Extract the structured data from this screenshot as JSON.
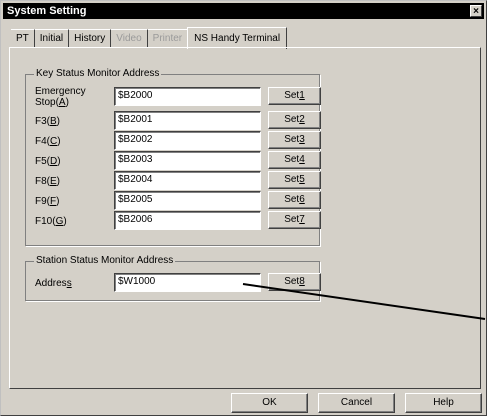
{
  "window": {
    "title": "System Setting",
    "close_glyph": "×"
  },
  "tabs": [
    {
      "label": "PT",
      "state": "normal"
    },
    {
      "label": "Initial",
      "state": "normal"
    },
    {
      "label": "History",
      "state": "normal"
    },
    {
      "label": "Video",
      "state": "disabled"
    },
    {
      "label": "Printer",
      "state": "disabled"
    },
    {
      "label": "NS Handy Terminal",
      "state": "active"
    }
  ],
  "key_group": {
    "legend": "Key Status Monitor Address",
    "rows": [
      {
        "label_pre": "Emergency\nStop(",
        "hotkey": "A",
        "label_post": ")",
        "value": "$B2000",
        "btn_pre": "Set",
        "btn_key": "1"
      },
      {
        "label_pre": "F3(",
        "hotkey": "B",
        "label_post": ")",
        "value": "$B2001",
        "btn_pre": "Set",
        "btn_key": "2"
      },
      {
        "label_pre": "F4(",
        "hotkey": "C",
        "label_post": ")",
        "value": "$B2002",
        "btn_pre": "Set",
        "btn_key": "3"
      },
      {
        "label_pre": "F5(",
        "hotkey": "D",
        "label_post": ")",
        "value": "$B2003",
        "btn_pre": "Set",
        "btn_key": "4"
      },
      {
        "label_pre": "F8(",
        "hotkey": "E",
        "label_post": ")",
        "value": "$B2004",
        "btn_pre": "Set",
        "btn_key": "5"
      },
      {
        "label_pre": "F9(",
        "hotkey": "F",
        "label_post": ")",
        "value": "$B2005",
        "btn_pre": "Set",
        "btn_key": "6"
      },
      {
        "label_pre": "F10(",
        "hotkey": "G",
        "label_post": ")",
        "value": "$B2006",
        "btn_pre": "Set",
        "btn_key": "7"
      }
    ]
  },
  "station_group": {
    "legend": "Station Status Monitor Address",
    "label_pre": "Addres",
    "hotkey": "s",
    "value": "$W1000",
    "btn_pre": "Set",
    "btn_key": "8"
  },
  "footer": {
    "ok": "OK",
    "cancel": "Cancel",
    "help": "Help"
  }
}
